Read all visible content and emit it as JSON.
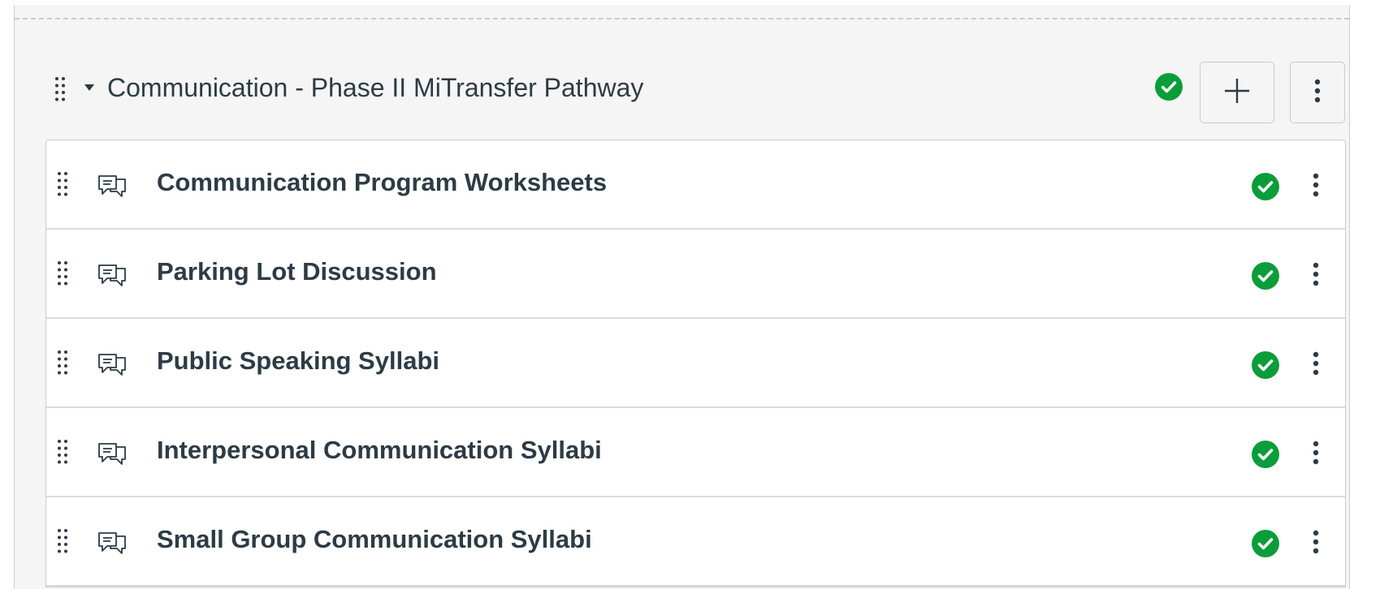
{
  "module": {
    "title": "Communication - Phase II MiTransfer Pathway",
    "status": "published",
    "status_color": "#0b9d39",
    "icons": {
      "drag": "drag-handle-icon",
      "toggle": "caret-down-icon",
      "published": "check-circle-icon",
      "add": "plus-icon",
      "menu": "kebab-menu-icon"
    }
  },
  "items": [
    {
      "title": "Communication Program Worksheets",
      "type_icon": "discussion-icon",
      "status": "published"
    },
    {
      "title": "Parking Lot Discussion",
      "type_icon": "discussion-icon",
      "status": "published"
    },
    {
      "title": "Public Speaking Syllabi",
      "type_icon": "discussion-icon",
      "status": "published"
    },
    {
      "title": "Interpersonal Communication Syllabi",
      "type_icon": "discussion-icon",
      "status": "published"
    },
    {
      "title": "Small Group Communication Syllabi",
      "type_icon": "discussion-icon",
      "status": "published"
    }
  ]
}
